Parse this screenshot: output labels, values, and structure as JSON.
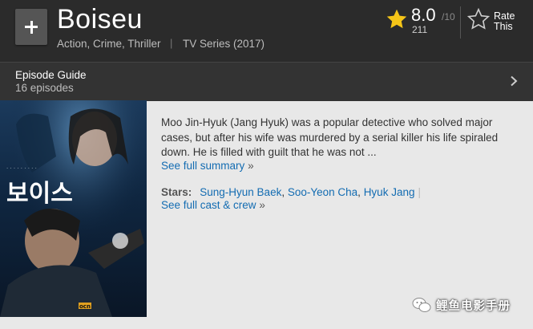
{
  "header": {
    "title": "Boiseu",
    "genres": "Action, Crime, Thriller",
    "separator": "|",
    "series_type": "TV Series (2017)"
  },
  "rating": {
    "value": "8.0",
    "max": "/10",
    "count": "211",
    "rate_label_line1": "Rate",
    "rate_label_line2": "This"
  },
  "episode_guide": {
    "title": "Episode Guide",
    "count": "16 episodes"
  },
  "poster": {
    "title_text": "보이스",
    "network": "ocn"
  },
  "summary": {
    "text": "Moo Jin-Hyuk (Jang Hyuk) was a popular detective who solved major cases, but after his wife was murdered by a serial killer his life spiraled down. He is filled with guilt that he was not ...",
    "see_full_summary": "See full summary",
    "more_arrow": "»"
  },
  "stars": {
    "label": "Stars:",
    "names": [
      "Sung-Hyun Baek",
      "Soo-Yeon Cha",
      "Hyuk Jang"
    ],
    "separator": "|",
    "see_full_cast": "See full cast & crew",
    "more_arrow": "»"
  },
  "watermark": {
    "text": "鲤鱼电影手册"
  },
  "colors": {
    "header_bg": "#2b2b2b",
    "episode_bar_bg": "#333333",
    "page_bg": "#e8e8e8",
    "link": "#136cb2",
    "star_gold": "#f5c518"
  }
}
